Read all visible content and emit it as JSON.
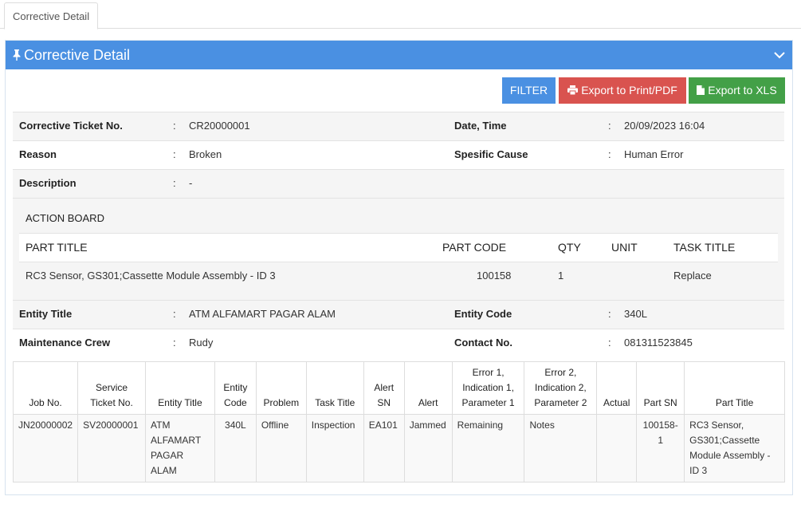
{
  "tab": {
    "label": "Corrective Detail"
  },
  "panel": {
    "title": "Corrective Detail"
  },
  "buttons": {
    "filter": "FILTER",
    "export_pdf": "Export to Print/PDF",
    "export_xls": "Export to XLS"
  },
  "colon": ":",
  "ticket": {
    "ticket_no_label": "Corrective Ticket No.",
    "ticket_no": "CR20000001",
    "datetime_label": "Date, Time",
    "datetime": "20/09/2023 16:04",
    "reason_label": "Reason",
    "reason": "Broken",
    "cause_label": "Spesific Cause",
    "cause": "Human Error",
    "description_label": "Description",
    "description": "-"
  },
  "action_board": {
    "title": "ACTION BOARD",
    "headers": {
      "part_title": "PART TITLE",
      "part_code": "PART CODE",
      "qty": "QTY",
      "unit": "UNIT",
      "task_title": "TASK TITLE"
    },
    "row": {
      "part_title": "RC3 Sensor, GS301;Cassette Module Assembly - ID 3",
      "part_code": "100158",
      "qty": "1",
      "unit": "",
      "task_title": "Replace"
    }
  },
  "entity": {
    "title_label": "Entity Title",
    "title": "ATM ALFAMART PAGAR ALAM",
    "code_label": "Entity Code",
    "code": "340L",
    "crew_label": "Maintenance Crew",
    "crew": "Rudy",
    "contact_label": "Contact No.",
    "contact": "081311523845"
  },
  "jobs": {
    "headers": {
      "job_no": "Job No.",
      "service_ticket_no": "Service Ticket No.",
      "entity_title": "Entity Title",
      "entity_code": "Entity Code",
      "problem": "Problem",
      "task_title": "Task Title",
      "alert_sn": "Alert SN",
      "alert": "Alert",
      "error1": "Error 1, Indication 1, Parameter 1",
      "error2": "Error 2, Indication 2, Parameter 2",
      "actual": "Actual",
      "part_sn": "Part SN",
      "part_title": "Part Title"
    },
    "rows": [
      {
        "job_no": "JN20000002",
        "service_ticket_no": "SV20000001",
        "entity_title": "ATM ALFAMART PAGAR ALAM",
        "entity_code": "340L",
        "problem": "Offline",
        "task_title": "Inspection",
        "alert_sn": "EA101",
        "alert": "Jammed",
        "error1": "Remaining",
        "error2": "Notes",
        "actual": "",
        "part_sn": "100158-1",
        "part_title": "RC3 Sensor, GS301;Cassette Module Assembly - ID 3"
      }
    ]
  },
  "colors": {
    "primary": "#4a90e2",
    "danger": "#d9534f",
    "success": "#43a047"
  },
  "icons": {
    "header": "pin-icon",
    "collapse": "chevron-down-icon",
    "pdf": "print-icon",
    "xls": "file-icon"
  }
}
